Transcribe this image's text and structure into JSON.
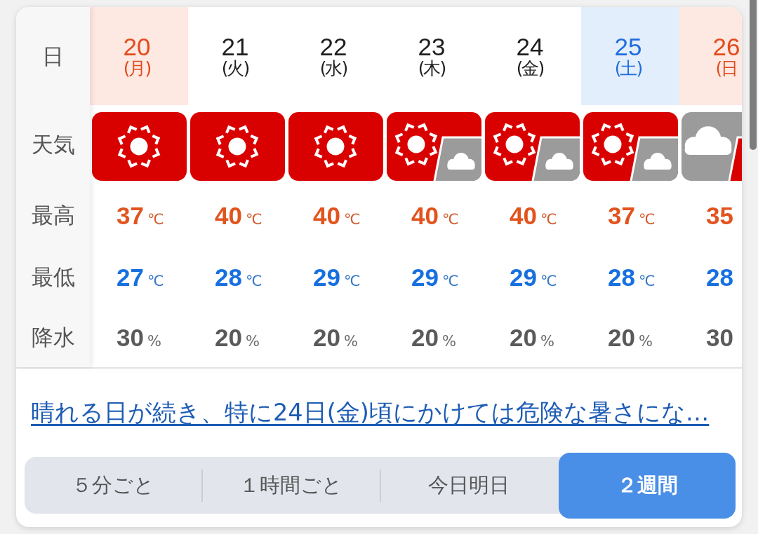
{
  "forecast": {
    "row_labels": [
      "日",
      "天気",
      "最高",
      "最低",
      "降水"
    ],
    "days": [
      {
        "date": "20",
        "weekday": "(月)",
        "kind": "holiday",
        "weather": {
          "kind": "sunny"
        },
        "high": "37",
        "high_unit": "℃",
        "low": "27",
        "low_unit": "℃",
        "precip": "30",
        "precip_unit": "%"
      },
      {
        "date": "21",
        "weekday": "(火)",
        "kind": "weekday",
        "weather": {
          "kind": "sunny"
        },
        "high": "40",
        "high_unit": "℃",
        "low": "28",
        "low_unit": "℃",
        "precip": "20",
        "precip_unit": "%"
      },
      {
        "date": "22",
        "weekday": "(水)",
        "kind": "weekday",
        "weather": {
          "kind": "sunny"
        },
        "high": "40",
        "high_unit": "℃",
        "low": "29",
        "low_unit": "℃",
        "precip": "20",
        "precip_unit": "%"
      },
      {
        "date": "23",
        "weekday": "(木)",
        "kind": "weekday",
        "weather": {
          "kind": "sunny-then-cloudy"
        },
        "high": "40",
        "high_unit": "℃",
        "low": "29",
        "low_unit": "℃",
        "precip": "20",
        "precip_unit": "%"
      },
      {
        "date": "24",
        "weekday": "(金)",
        "kind": "weekday",
        "weather": {
          "kind": "sunny-then-cloudy"
        },
        "high": "40",
        "high_unit": "℃",
        "low": "29",
        "low_unit": "℃",
        "precip": "20",
        "precip_unit": "%"
      },
      {
        "date": "25",
        "weekday": "(土)",
        "kind": "saturday",
        "weather": {
          "kind": "sunny-then-cloudy"
        },
        "high": "37",
        "high_unit": "℃",
        "low": "28",
        "low_unit": "℃",
        "precip": "20",
        "precip_unit": "%"
      },
      {
        "date": "26",
        "weekday": "(日",
        "kind": "holiday",
        "weather": {
          "kind": "cloudy-then-sunny"
        },
        "high": "35",
        "low": "28",
        "precip": "30"
      }
    ]
  },
  "summary_link": "晴れる日が続き、特に24日(金)頃にかけては危険な暑さにな…",
  "view_tabs": [
    {
      "label": "５分ごと",
      "selected": false
    },
    {
      "label": "１時間ごと",
      "selected": false
    },
    {
      "label": "今日明日",
      "selected": false
    },
    {
      "label": "２週間",
      "selected": true
    }
  ]
}
